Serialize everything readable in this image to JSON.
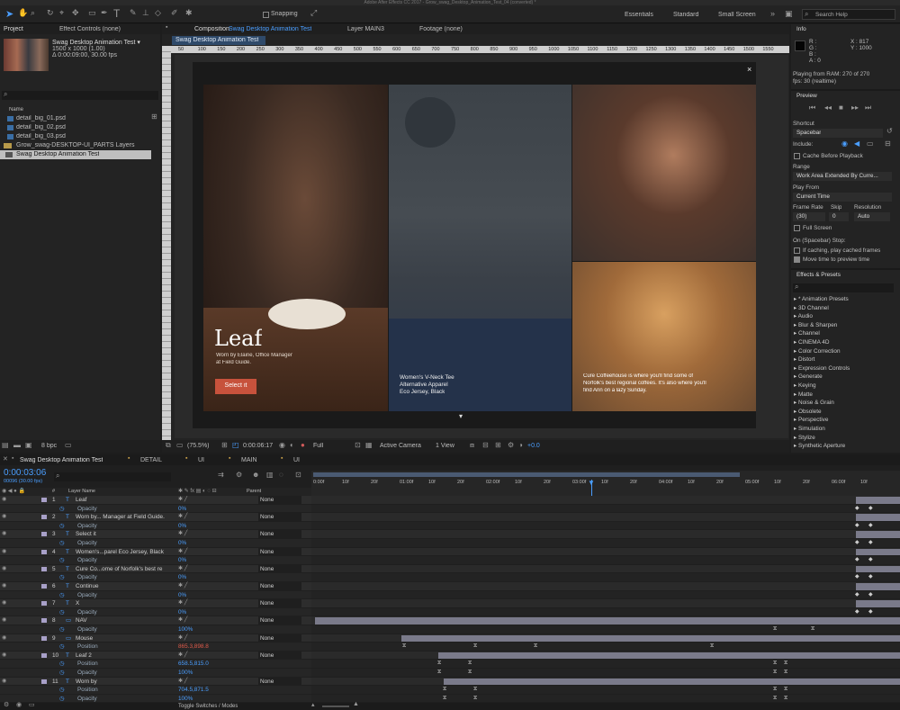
{
  "app": {
    "title": "Adobe After Effects CC 2017 - Grow_swag_Desktop_Animation_Test_04 (converted) *"
  },
  "toolbar": {
    "snapping": "Snapping",
    "workspaces": [
      "Essentials",
      "Standard",
      "Small Screen"
    ],
    "search_help": "Search Help"
  },
  "project": {
    "tab_project": "Project",
    "tab_effect_controls": "Effect Controls (none)",
    "comp_name": "Swag Desktop Animation Test ▾",
    "comp_size": "1500 x 1000 (1.00)",
    "comp_duration": "Δ 0:00:09:00, 30.00 fps",
    "col_name": "Name",
    "items": [
      "detail_big_01.psd",
      "detail_big_02.psd",
      "detail_big_03.psd",
      "Grow_swag-DESKTOP-UI_PARTS Layers",
      "Swag Desktop Animation Test"
    ],
    "bpc": "8 bpc"
  },
  "composition": {
    "tab_label": "Composition",
    "tab_comp": "Swag Desktop Animation Test",
    "tab_layer": "Layer MAIN3",
    "tab_footage": "Footage (none)",
    "sub_tab": "Swag Desktop Animation Test",
    "ruler": [
      "50",
      "100",
      "150",
      "200",
      "250",
      "300",
      "350",
      "400",
      "450",
      "500",
      "550",
      "600",
      "650",
      "700",
      "750",
      "800",
      "850",
      "900",
      "950",
      "1000",
      "1050",
      "1100",
      "1150",
      "1200",
      "1250",
      "1300",
      "1350",
      "1400",
      "1450",
      "1500",
      "1550"
    ],
    "close": "×",
    "panel1": {
      "heading": "Leaf",
      "desc_line1": "Worn by Elaine, Office Manager",
      "desc_line2": "at Field Guide.",
      "button": "Select it"
    },
    "panel2": {
      "line1": "Women's V-Neck Tee",
      "line2": "Alternative Apparel",
      "line3": "Eco Jersey, Black"
    },
    "panel3": {
      "line1": "Cure Coffeehouse is where you'll find some of",
      "line2": "Norfolk's best regional coffees. It's also where you'll",
      "line3": "find Ann on a lazy Sunday."
    },
    "footer": {
      "zoom": "(75.5%)",
      "time": "0:00:06:17",
      "resolution": "Full",
      "camera": "Active Camera",
      "view": "1 View",
      "exposure": "+0.0"
    }
  },
  "info": {
    "title": "Info",
    "rgba": [
      "R :",
      "G :",
      "B :",
      "A : 0"
    ],
    "xy": [
      "X : 817",
      "Y : 1000"
    ],
    "playing1": "Playing from RAM: 270 of 270",
    "playing2": "fps: 30 (realtime)"
  },
  "preview": {
    "title": "Preview",
    "shortcut_label": "Shortcut",
    "shortcut_value": "Spacebar",
    "include_label": "Include:",
    "cache_label": "Cache Before Playback",
    "range_label": "Range",
    "range_value": "Work Area Extended By Curre...",
    "play_from_label": "Play From",
    "play_from_value": "Current Time",
    "frame_rate_label": "Frame Rate",
    "skip_label": "Skip",
    "resolution_label": "Resolution",
    "frame_rate_value": "(30)",
    "skip_value": "0",
    "resolution_value": "Auto",
    "full_screen": "Full Screen",
    "on_stop": "On (Spacebar) Stop:",
    "if_caching": "If caching, play cached frames",
    "move_time": "Move time to preview time"
  },
  "effects": {
    "title": "Effects & Presets",
    "items": [
      "* Animation Presets",
      "3D Channel",
      "Audio",
      "Blur & Sharpen",
      "Channel",
      "CINEMA 4D",
      "Color Correction",
      "Distort",
      "Expression Controls",
      "Generate",
      "Keying",
      "Matte",
      "Noise & Grain",
      "Obsolete",
      "Perspective",
      "Simulation",
      "Stylize",
      "Synthetic Aperture",
      "Text"
    ]
  },
  "timeline": {
    "tabs": [
      "Swag Desktop Animation Test",
      "DETAIL",
      "UI",
      "MAIN",
      "UI"
    ],
    "current_time": "0:00:03:06",
    "frame_info": "00096 (30.00 fps)",
    "col_num": "#",
    "col_layer_name": "Layer Name",
    "col_parent": "Parent",
    "ruler": [
      "0:00f",
      "10f",
      "20f",
      "01:00f",
      "10f",
      "20f",
      "02:00f",
      "10f",
      "20f",
      "03:00f",
      "10f",
      "20f",
      "04:00f",
      "10f",
      "20f",
      "05:00f",
      "10f",
      "20f",
      "06:00f",
      "10f"
    ],
    "toggle": "Toggle Switches / Modes",
    "rows": [
      {
        "type": "layer",
        "num": "1",
        "name": "Leaf",
        "parent": "None"
      },
      {
        "type": "prop",
        "name": "Opacity",
        "value": "0%"
      },
      {
        "type": "layer",
        "num": "2",
        "name": "Worn by... Manager at Field Guide.",
        "parent": "None"
      },
      {
        "type": "prop",
        "name": "Opacity",
        "value": "0%"
      },
      {
        "type": "layer",
        "num": "3",
        "name": "Select it",
        "parent": "None"
      },
      {
        "type": "prop",
        "name": "Opacity",
        "value": "0%"
      },
      {
        "type": "layer",
        "num": "4",
        "name": "Women's...parel Eco Jersey, Black",
        "parent": "None"
      },
      {
        "type": "prop",
        "name": "Opacity",
        "value": "0%"
      },
      {
        "type": "layer",
        "num": "5",
        "name": "Cure Co...ome of Norfolk's best re",
        "parent": "None"
      },
      {
        "type": "prop",
        "name": "Opacity",
        "value": "0%"
      },
      {
        "type": "layer",
        "num": "6",
        "name": "Continue",
        "parent": "None"
      },
      {
        "type": "prop",
        "name": "Opacity",
        "value": "0%"
      },
      {
        "type": "layer",
        "num": "7",
        "name": "X",
        "parent": "None"
      },
      {
        "type": "prop",
        "name": "Opacity",
        "value": "0%"
      },
      {
        "type": "layer",
        "num": "8",
        "name": "NAV",
        "parent": "None"
      },
      {
        "type": "prop",
        "name": "Opacity",
        "value": "100%"
      },
      {
        "type": "layer",
        "num": "9",
        "name": "Mouse",
        "parent": "None"
      },
      {
        "type": "prop",
        "name": "Position",
        "value": "865.3,898.8",
        "red": true
      },
      {
        "type": "layer",
        "num": "10",
        "name": "Leaf 2",
        "parent": "None"
      },
      {
        "type": "prop",
        "name": "Position",
        "value": "658.5,815.0"
      },
      {
        "type": "prop",
        "name": "Opacity",
        "value": "100%"
      },
      {
        "type": "layer",
        "num": "11",
        "name": "Worn by",
        "parent": "None"
      },
      {
        "type": "prop",
        "name": "Position",
        "value": "704.5,871.5"
      },
      {
        "type": "prop",
        "name": "Opacity",
        "value": "100%"
      }
    ]
  }
}
